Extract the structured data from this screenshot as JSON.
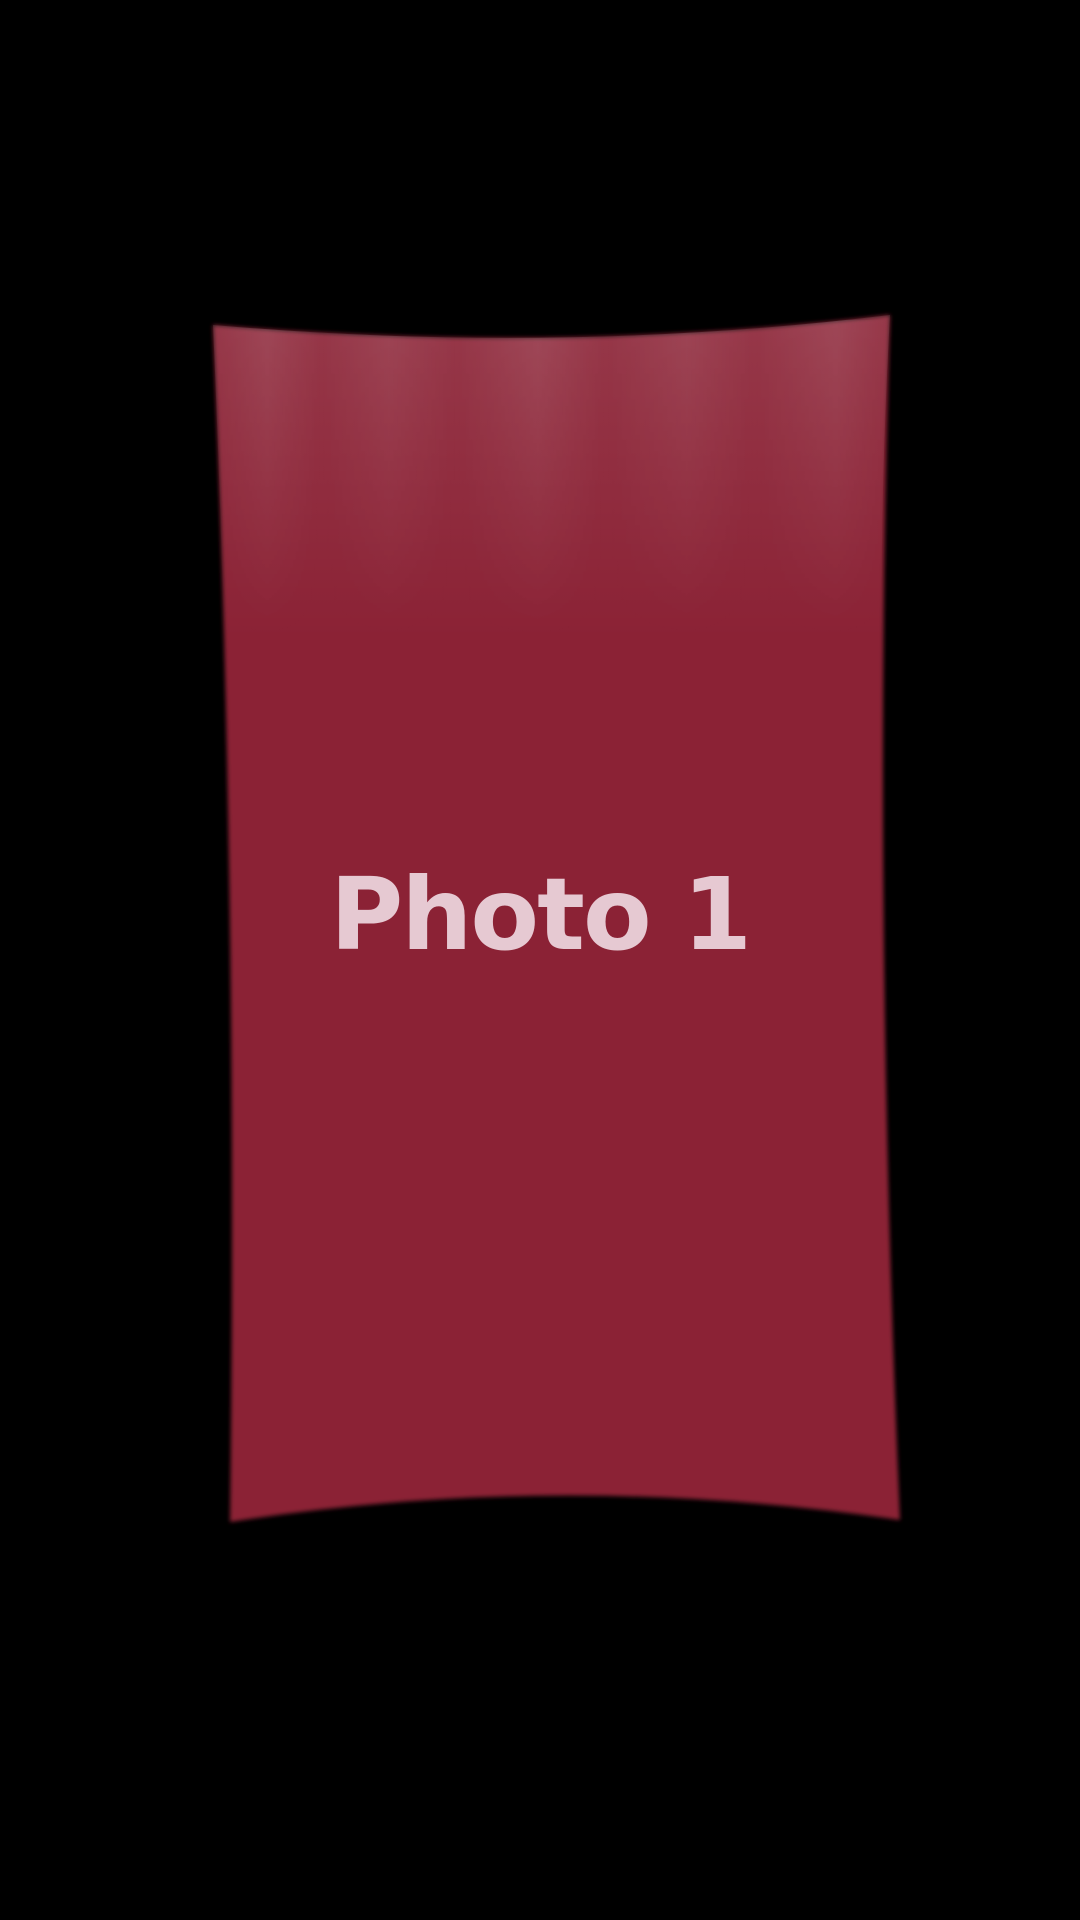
{
  "photo": {
    "label": "Photo 1",
    "color": "#8b2236",
    "label_color": "#e6c9d2"
  },
  "background_color": "#000000"
}
